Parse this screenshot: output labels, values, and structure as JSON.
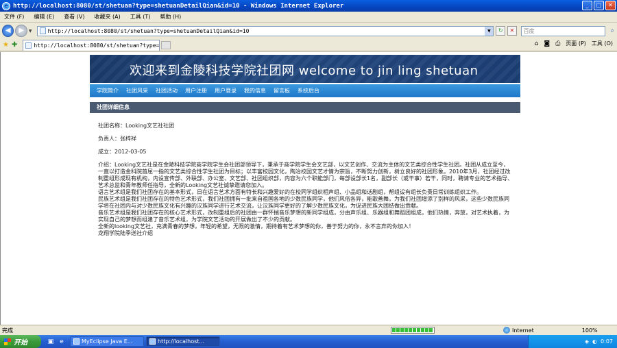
{
  "window": {
    "title": "http://localhost:8080/st/shetuan?type=shetuanDetailQian&id=10 - Windows Internet Explorer",
    "buttons": [
      "_",
      "□",
      "✕"
    ]
  },
  "menu": [
    "文件 (F)",
    "编辑 (E)",
    "查看 (V)",
    "收藏夹 (A)",
    "工具 (T)",
    "帮助 (H)"
  ],
  "address": {
    "url": "http://localhost:8080/st/shetuan?type=shetuanDetailQian&id=10",
    "search_placeholder": "百度"
  },
  "tab": {
    "label": "http://localhost:8080/st/shetuan?type=she...",
    "commands": [
      "页面 (P)",
      "工具 (O)"
    ]
  },
  "page": {
    "banner": "欢迎来到金陵科技学院社团网  welcome to jin ling shetuan",
    "nav": [
      "学院简介",
      "社团风采",
      "社团活动",
      "用户注册",
      "用户登录",
      "我的信息",
      "留言板",
      "系统后台"
    ],
    "section_title": "社团详细信息",
    "fields": {
      "name": "社团名称：Looking文艺社社团",
      "leader": "负责人：张梓祥",
      "founded": "成立：2012-03-05"
    },
    "intro": [
      "介绍：Looking文艺社是在金陵科技学院商学院学生会社团部领导下，秉承于商学院学生会文艺部，以文艺创作、交流为主体的文艺类综合性学生社团。社团从成立至今，一直以打造金科院首屈一指的文艺类综合性学生社团为目标；以丰富校园文化，陶冶校园文艺才情为宗旨，不断努力创新，树立良好的社团形象。2010年3月，社团经过改制重组形成现有机构，内设宣传部、外联部、办公室、文艺部、社团组织部，内容为六个职能部门，每部设部长1名，副部长（或干事）若干，同时，聘请专业的艺术指导、艺术总监和青年教师任指导，全新的Looking文艺社诚挚邀请您加入。",
      "语言艺术组是我们社团存在的基本形式，日在语言艺术方面有特长和兴趣爱好的在校同学组织相声组、小品组和话剧组，帮组设有组长负责日常训练组织工作。",
      "民族艺术组是我们社团存在的特色艺术形式，我们社团拥有一批来自祖国各地的少数民族同学，他们风俗各异，能歌善舞，为我们社团增添了别样的风采，这些少数民族同学将在社团内与对少数民族文化有兴趣的汉族同学进行艺术交流，让汉族同学更好的了解少数民族文化，为促进民族大团结做出贡献。",
      "音乐艺术组是我们社团存在的核心艺术形式，改制重组后的社团由一群怀揣音乐梦想的新同学组成，分由声乐组、乐器组和舞蹈团组成，他们热情，奔放，对艺术执着，为实现自己的梦想而组建了音乐艺术组，为学院文艺活动的开展做出了不少的贡献。",
      "全新的looking文艺社，充满青春的梦想，年轻的希望，无限的激情，期待着有艺术梦想的你，善于努力的你，永不言弃的你加入！",
      "龙翔学院陆季送社介绍"
    ]
  },
  "status": {
    "text": "完成",
    "zone": "Internet",
    "zoom": "100%",
    "progress": 0.92
  },
  "taskbar": {
    "start": "开始",
    "buttons": [
      "MyEclipse Java E...",
      "http://localhost..."
    ],
    "clock": "0:07"
  }
}
